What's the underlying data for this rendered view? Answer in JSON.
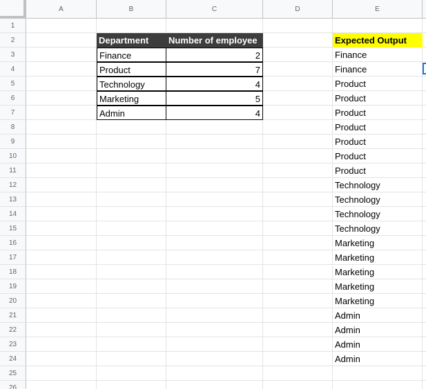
{
  "columns": [
    "A",
    "B",
    "C",
    "D",
    "E"
  ],
  "rows": [
    "1",
    "2",
    "3",
    "4",
    "5",
    "6",
    "7",
    "8",
    "9",
    "10",
    "11",
    "12",
    "13",
    "14",
    "15",
    "16",
    "17",
    "18",
    "19",
    "20",
    "21",
    "22",
    "23",
    "24",
    "25",
    "26"
  ],
  "table": {
    "headers": [
      "Department",
      "Number of employee"
    ],
    "rows": [
      {
        "department": "Finance",
        "count": "2"
      },
      {
        "department": "Product",
        "count": "7"
      },
      {
        "department": "Technology",
        "count": "4"
      },
      {
        "department": "Marketing",
        "count": "5"
      },
      {
        "department": "Admin",
        "count": "4"
      }
    ]
  },
  "expected_output": {
    "header": "Expected Output",
    "values": [
      "Finance",
      "Finance",
      "Product",
      "Product",
      "Product",
      "Product",
      "Product",
      "Product",
      "Product",
      "Technology",
      "Technology",
      "Technology",
      "Technology",
      "Marketing",
      "Marketing",
      "Marketing",
      "Marketing",
      "Marketing",
      "Admin",
      "Admin",
      "Admin",
      "Admin"
    ]
  },
  "colors": {
    "header_bg": "#3d3d3d",
    "highlight": "#ffff00",
    "selection": "#1a73e8",
    "grid": "#e2e3e3"
  }
}
